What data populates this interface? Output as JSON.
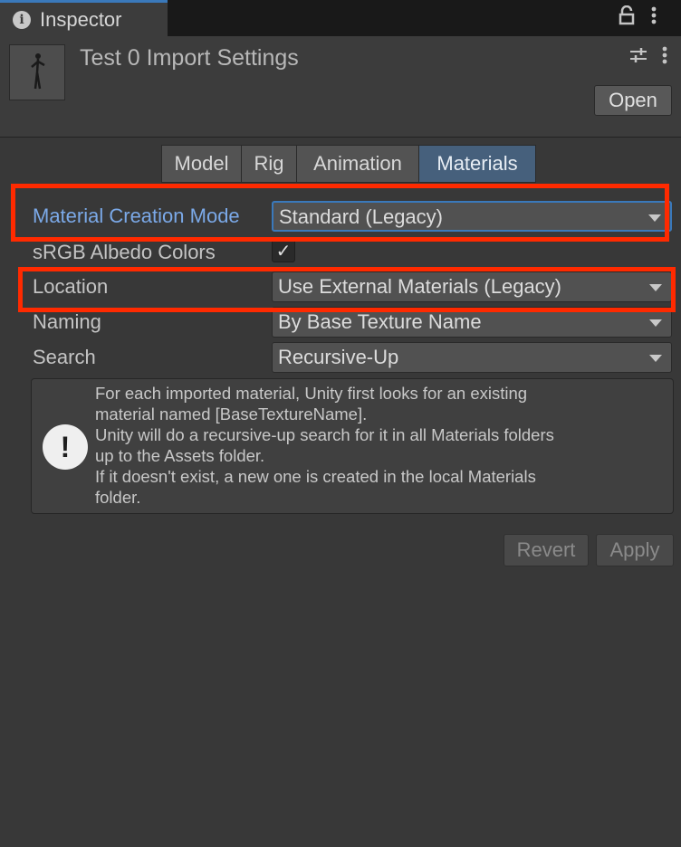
{
  "tab": {
    "title": "Inspector",
    "info_icon": "i"
  },
  "tab_controls": {
    "lock_icon": "lock-icon",
    "more_icon": "kebab-menu-icon"
  },
  "header": {
    "title": "Test 0 Import Settings",
    "settings_icon": "preset-sliders-icon",
    "more_icon": "kebab-menu-icon",
    "open_label": "Open"
  },
  "subtabs": [
    {
      "label": "Model",
      "active": false
    },
    {
      "label": "Rig",
      "active": false
    },
    {
      "label": "Animation",
      "active": false
    },
    {
      "label": "Materials",
      "active": true
    }
  ],
  "fields": {
    "material_creation_mode": {
      "label": "Material Creation Mode",
      "value": "Standard (Legacy)"
    },
    "srgb_albedo_colors": {
      "label": "sRGB Albedo Colors",
      "checked": true,
      "check_glyph": "✓"
    },
    "location": {
      "label": "Location",
      "value": "Use External Materials (Legacy)"
    },
    "naming": {
      "label": "Naming",
      "value": "By Base Texture Name"
    },
    "search": {
      "label": "Search",
      "value": "Recursive-Up"
    }
  },
  "help": {
    "icon": "!",
    "lines": [
      "For each imported material, Unity first looks for an existing",
      "material named [BaseTextureName].",
      "Unity will do a recursive-up search for it in all Materials folders",
      "up to the Assets folder.",
      "If it doesn't exist, a new one is created in the local Materials",
      "folder."
    ]
  },
  "buttons": {
    "revert": "Revert",
    "apply": "Apply"
  },
  "colors": {
    "highlight": "#ff2a00",
    "accent": "#3a79bb",
    "active_tab": "#46607c",
    "label_focus": "#7ba9e8"
  }
}
